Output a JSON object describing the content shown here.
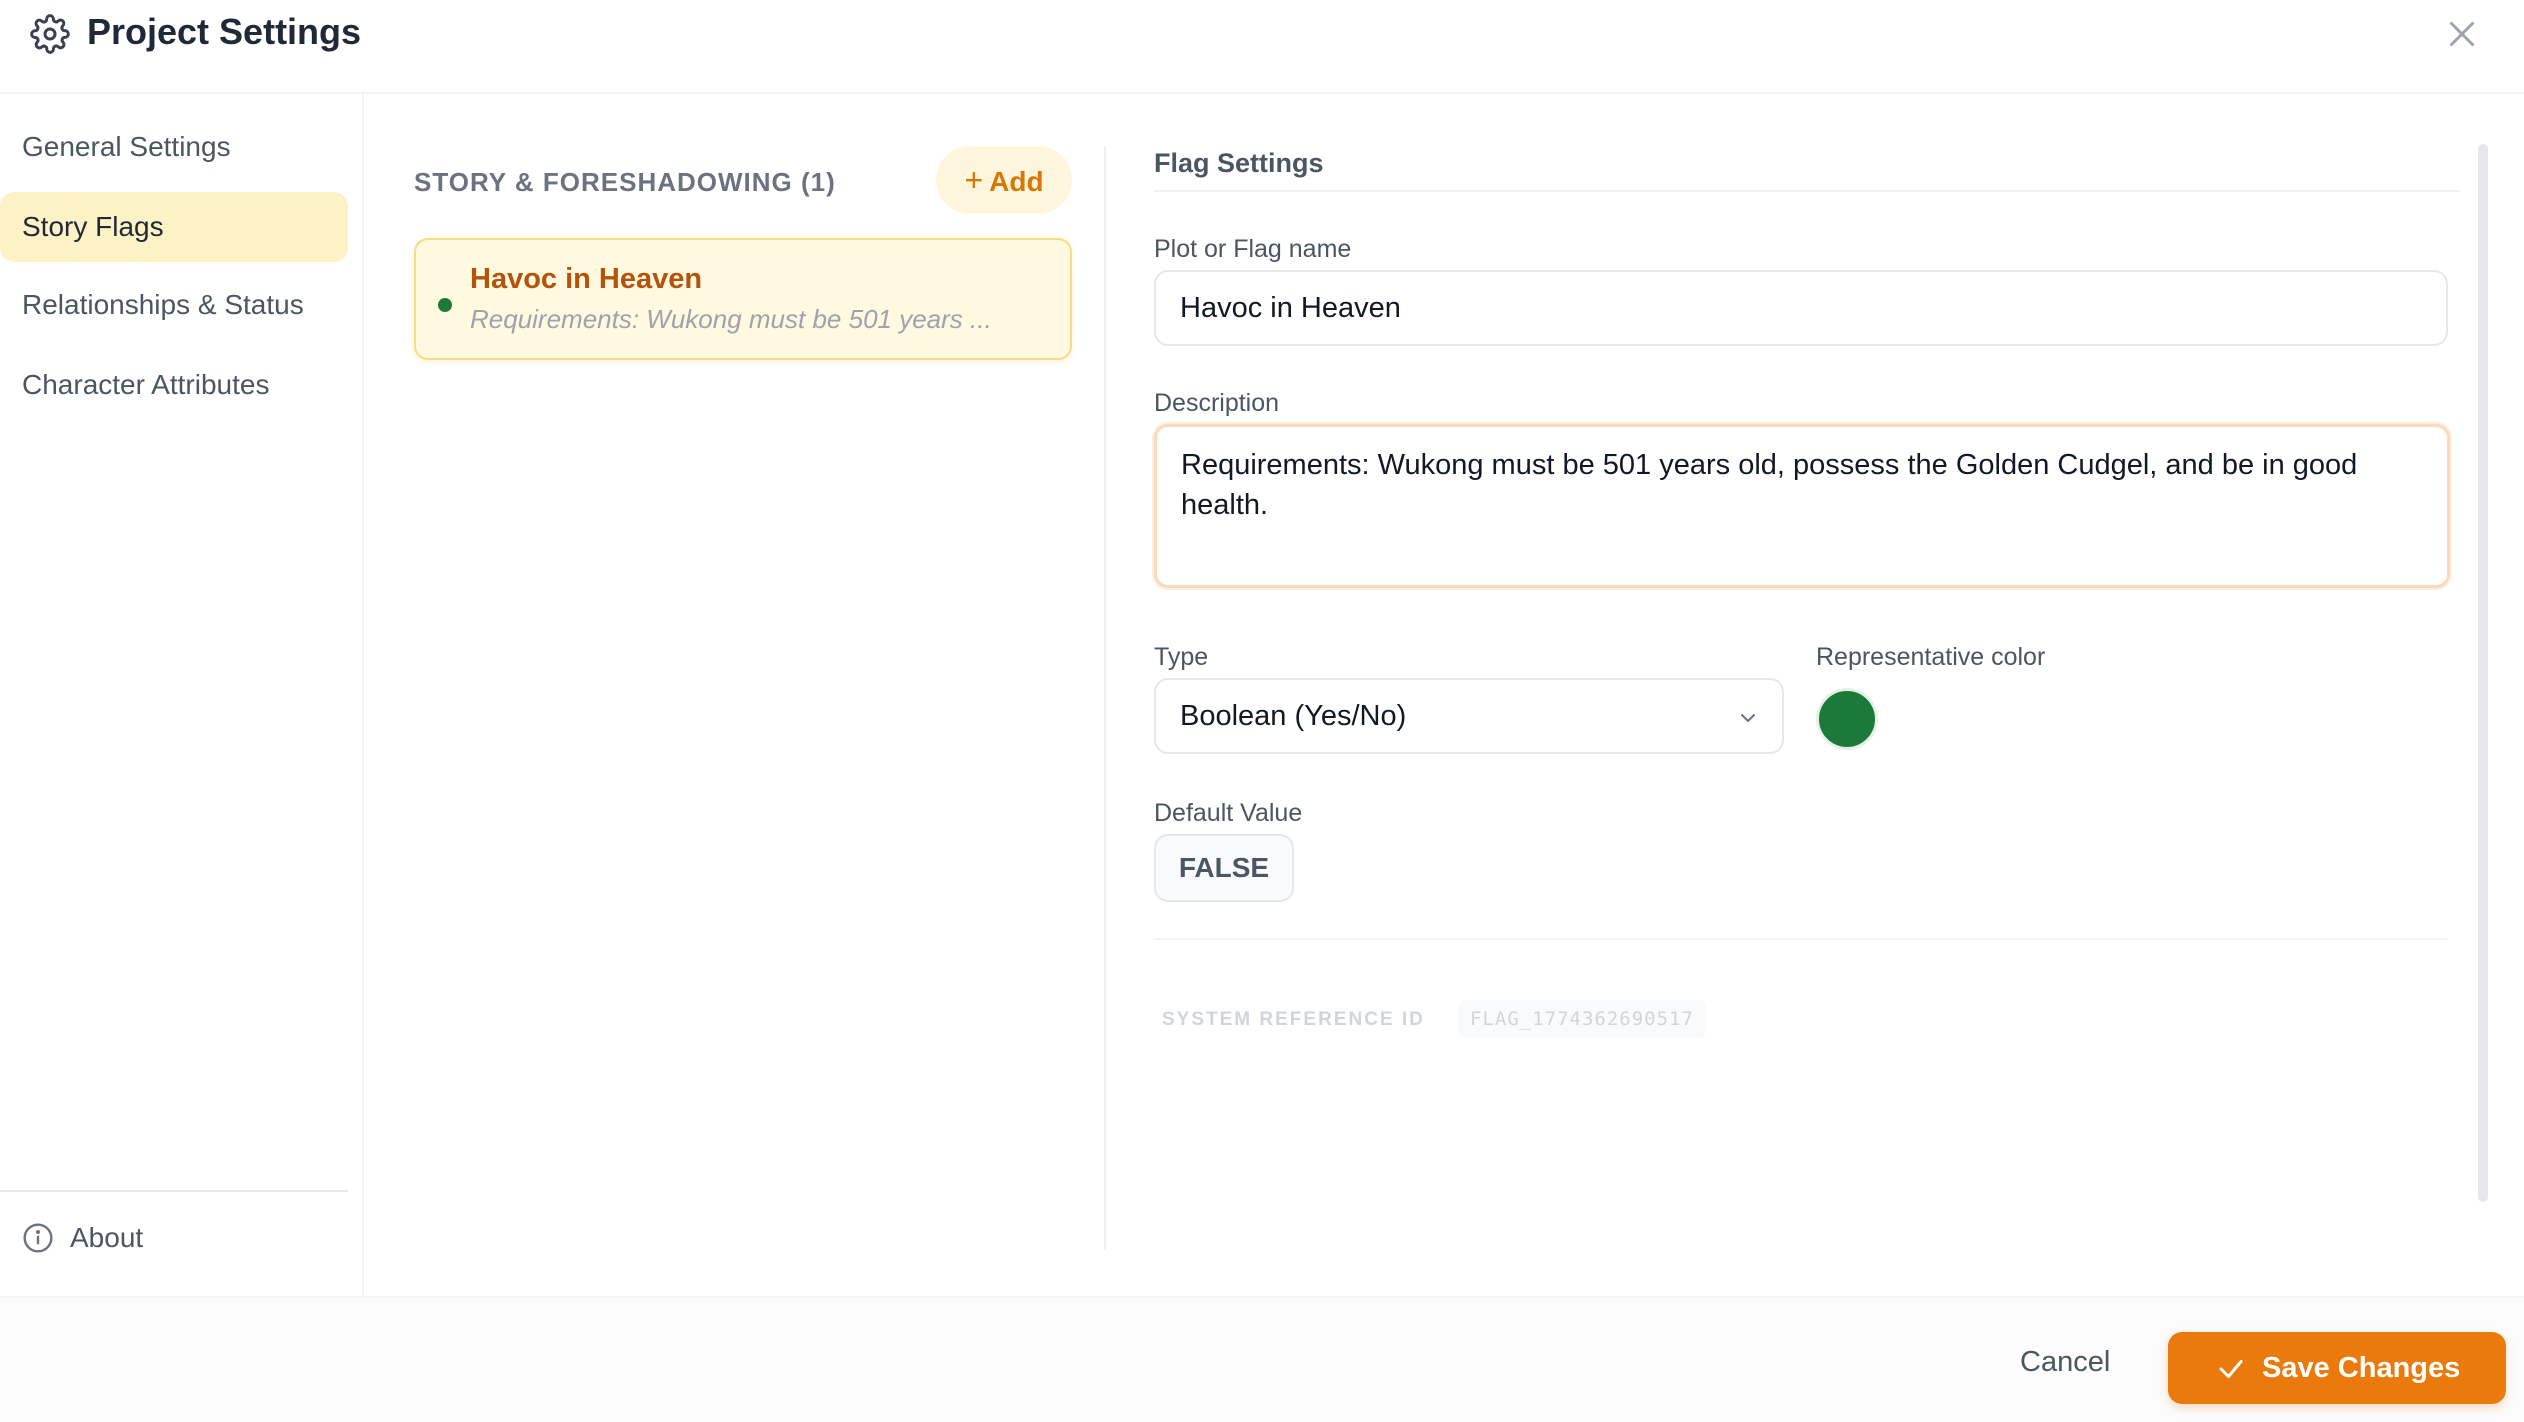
{
  "header": {
    "title": "Project Settings",
    "icon": "gear-icon",
    "close_icon": "close-icon"
  },
  "nav": {
    "items": [
      {
        "label": "General Settings",
        "active": false
      },
      {
        "label": "Story Flags",
        "active": true
      },
      {
        "label": "Relationships & Status",
        "active": false
      },
      {
        "label": "Character Attributes",
        "active": false
      }
    ],
    "about": {
      "label": "About",
      "icon": "info-icon"
    }
  },
  "flags_list": {
    "section_title": "STORY & FORESHADOWING (1)",
    "add_label": "Add",
    "items": [
      {
        "name": "Havoc in Heaven",
        "description": "Requirements: Wukong must be 501 years ...",
        "color": "#1b7a3a"
      }
    ]
  },
  "flag_settings": {
    "title": "Flag Settings",
    "name_label": "Plot or Flag name",
    "name_value": "Havoc in Heaven",
    "description_label": "Description",
    "description_value": "Requirements: Wukong must be 501 years old, possess the Golden Cudgel, and be in good health.",
    "type_label": "Type",
    "type_value": "Boolean (Yes/No)",
    "color_label": "Representative color",
    "color_value": "#1b7a3a",
    "default_label": "Default Value",
    "default_value": "FALSE",
    "ref_label": "SYSTEM REFERENCE ID",
    "ref_value": "FLAG_1774362690517"
  },
  "footer": {
    "cancel_label": "Cancel",
    "save_label": "Save Changes"
  },
  "colors": {
    "accent": "#ea7a0c",
    "accent_text": "#b45309",
    "active_nav_bg": "#fdf1c6",
    "flag_green": "#1b7a3a"
  }
}
